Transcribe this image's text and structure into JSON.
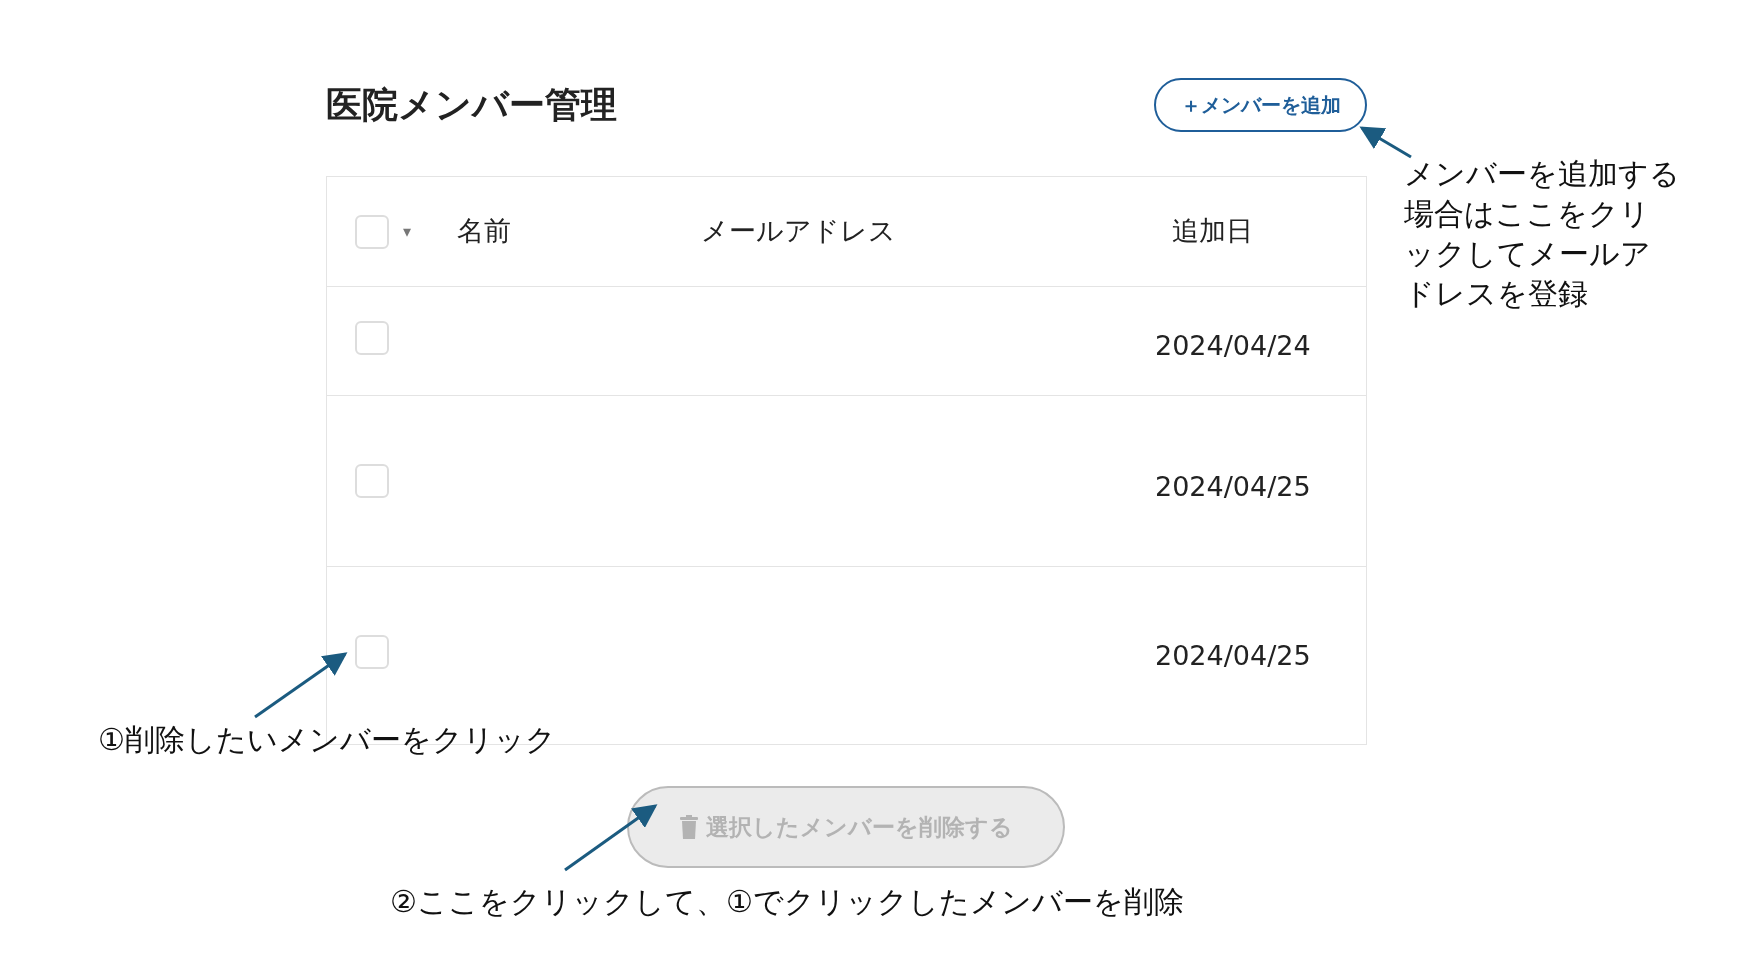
{
  "page": {
    "title": "医院メンバー管理",
    "add_button": "＋メンバーを追加"
  },
  "table": {
    "select_all": {
      "checked": false
    },
    "caret": "▾",
    "columns": [
      "名前",
      "メールアドレス",
      "追加日"
    ],
    "rows": [
      {
        "checked": false,
        "date": "2024/04/24"
      },
      {
        "checked": false,
        "date": "2024/04/25"
      },
      {
        "checked": false,
        "date": "2024/04/25"
      }
    ]
  },
  "delete_button": {
    "label": "選択したメンバーを削除する",
    "disabled": true
  },
  "annotations": [
    {
      "kind": "add",
      "text": "メンバーを追加する場合はここをクリックしてメールアドレスを登録"
    },
    {
      "kind": "select",
      "text": "①削除したいメンバーをクリック"
    },
    {
      "kind": "delete",
      "text": "②ここをクリックして、①でクリックしたメンバーを削除"
    }
  ]
}
